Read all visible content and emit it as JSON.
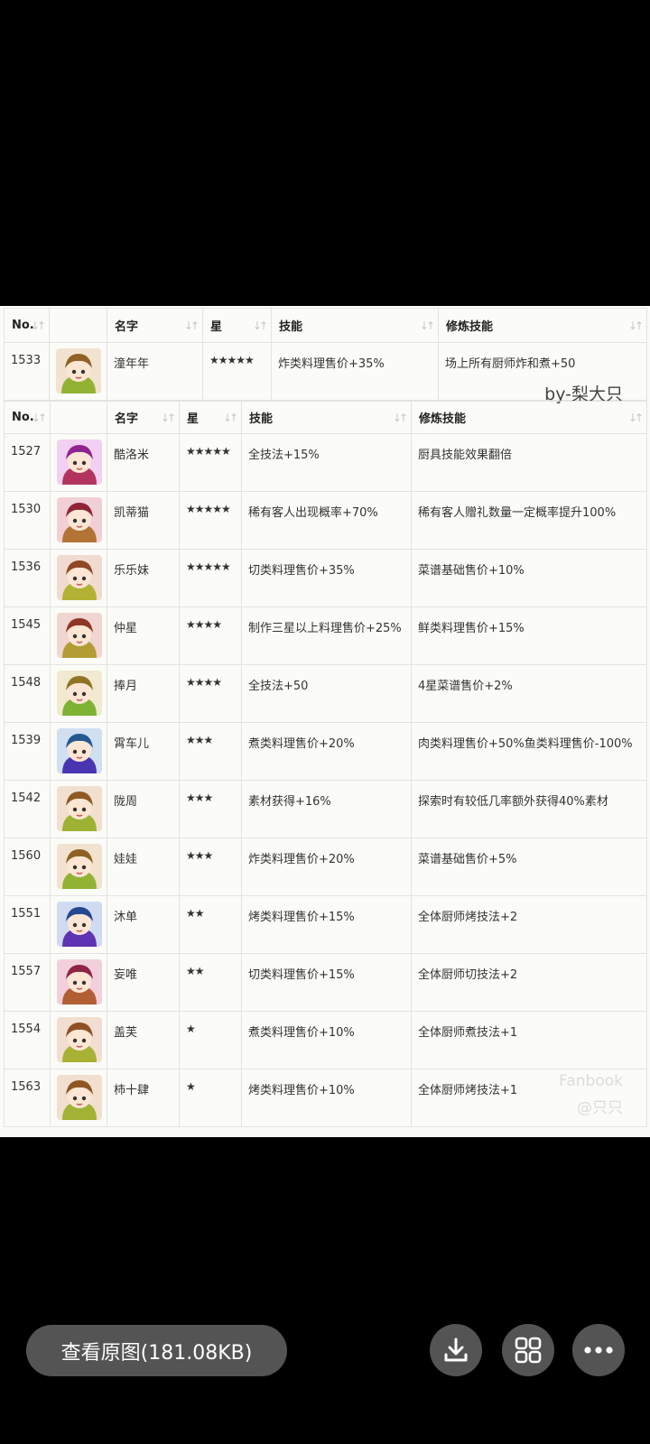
{
  "table_top": {
    "headers": [
      "No.",
      "",
      "名字",
      "星",
      "技能",
      "修炼技能"
    ],
    "row": {
      "no": "1533",
      "name": "潼年年",
      "stars": "★★★★★",
      "skill": "炸类料理售价+35%",
      "train": "场上所有厨师炸和煮+50"
    }
  },
  "credit": "by-梨大只",
  "table_main": {
    "headers": [
      "No.",
      "",
      "名字",
      "星",
      "技能",
      "修炼技能"
    ],
    "rows": [
      {
        "no": "1527",
        "name": "酷洛米",
        "stars": "★★★★★",
        "skill": "全技法+15%",
        "train": "厨具技能效果翻倍"
      },
      {
        "no": "1530",
        "name": "凯蒂猫",
        "stars": "★★★★★",
        "skill": "稀有客人出现概率+70%",
        "train": "稀有客人赠礼数量一定概率提升100%"
      },
      {
        "no": "1536",
        "name": "乐乐妹",
        "stars": "★★★★★",
        "skill": "切类料理售价+35%",
        "train": "菜谱基础售价+10%"
      },
      {
        "no": "1545",
        "name": "仲星",
        "stars": "★★★★",
        "skill": "制作三星以上料理售价+25%",
        "train": "鲜类料理售价+15%"
      },
      {
        "no": "1548",
        "name": "捧月",
        "stars": "★★★★",
        "skill": "全技法+50",
        "train": "4星菜谱售价+2%"
      },
      {
        "no": "1539",
        "name": "霄车儿",
        "stars": "★★★",
        "skill": "煮类料理售价+20%",
        "train": "肉类料理售价+50%鱼类料理售价-100%"
      },
      {
        "no": "1542",
        "name": "陇周",
        "stars": "★★★",
        "skill": "素材获得+16%",
        "train": "探索时有较低几率额外获得40%素材"
      },
      {
        "no": "1560",
        "name": "娃娃",
        "stars": "★★★",
        "skill": "炸类料理售价+20%",
        "train": "菜谱基础售价+5%"
      },
      {
        "no": "1551",
        "name": "沐单",
        "stars": "★★",
        "skill": "烤类料理售价+15%",
        "train": "全体厨师烤技法+2"
      },
      {
        "no": "1557",
        "name": "妄唯",
        "stars": "★★",
        "skill": "切类料理售价+15%",
        "train": "全体厨师切技法+2"
      },
      {
        "no": "1554",
        "name": "盖芙",
        "stars": "★",
        "skill": "煮类料理售价+10%",
        "train": "全体厨师煮技法+1"
      },
      {
        "no": "1563",
        "name": "柿十肆",
        "stars": "★",
        "skill": "烤类料理售价+10%",
        "train": "全体厨师烤技法+1"
      }
    ]
  },
  "watermark": {
    "line1": "Fanbook",
    "line2": "@只只"
  },
  "toolbar": {
    "view_original": "查看原图(181.08KB)",
    "download_icon": "download-icon",
    "grid_icon": "grid-icon",
    "more_icon": "more-icon"
  }
}
